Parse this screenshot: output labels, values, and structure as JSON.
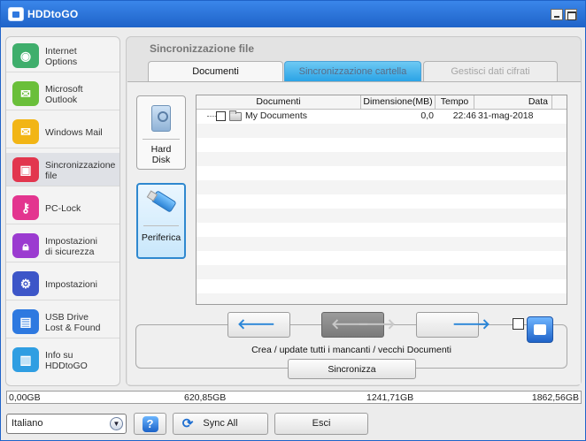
{
  "window": {
    "title": "HDDtoGO"
  },
  "sidebar": {
    "items": [
      {
        "label": "Internet\nOptions",
        "icon": "globe-icon",
        "color": "#3fae6c"
      },
      {
        "label": "Microsoft\nOutlook",
        "icon": "outlook-icon",
        "color": "#6abf3a"
      },
      {
        "label": "Windows Mail",
        "icon": "mail-icon",
        "color": "#f2b515"
      },
      {
        "label": "Sincronizzazione\nfile",
        "icon": "folder-sync-icon",
        "color": "#e2364e"
      },
      {
        "label": "PC-Lock",
        "icon": "key-icon",
        "color": "#e3358f"
      },
      {
        "label": "Impostazioni\ndi sicurezza",
        "icon": "lock-icon",
        "color": "#9b3bd0"
      },
      {
        "label": "Impostazioni",
        "icon": "gears-icon",
        "color": "#3d56c8"
      },
      {
        "label": "USB Drive\nLost & Found",
        "icon": "usb-icon",
        "color": "#2e79e0"
      },
      {
        "label": "Info su\nHDDtoGO",
        "icon": "briefcase-icon",
        "color": "#2f9ee2"
      }
    ],
    "active_index": 3
  },
  "main": {
    "title": "Sincronizzazione file",
    "tabs": [
      {
        "label": "Documenti"
      },
      {
        "label": "Sincronizzazione cartella"
      },
      {
        "label": "Gestisci dati cifrati"
      }
    ]
  },
  "sources": {
    "hard_disk": "Hard\nDisk",
    "device": "Periferica"
  },
  "table": {
    "columns": [
      "Documenti",
      "Dimensione(MB)",
      "Tempo",
      "Data"
    ],
    "rows": [
      {
        "name": "My Documents",
        "size": "0,0",
        "time": "22:46",
        "date": "31-mag-2018"
      }
    ]
  },
  "sync": {
    "description": "Crea / update tutti i mancanti / vecchi Documenti",
    "button_label": "Sincronizza"
  },
  "capacity": {
    "ticks": [
      "0,00GB",
      "620,85GB",
      "1241,71GB",
      "1862,56GB"
    ]
  },
  "bottom": {
    "language": "Italiano",
    "help_label": "?",
    "sync_all_label": "Sync All",
    "exit_label": "Esci"
  }
}
